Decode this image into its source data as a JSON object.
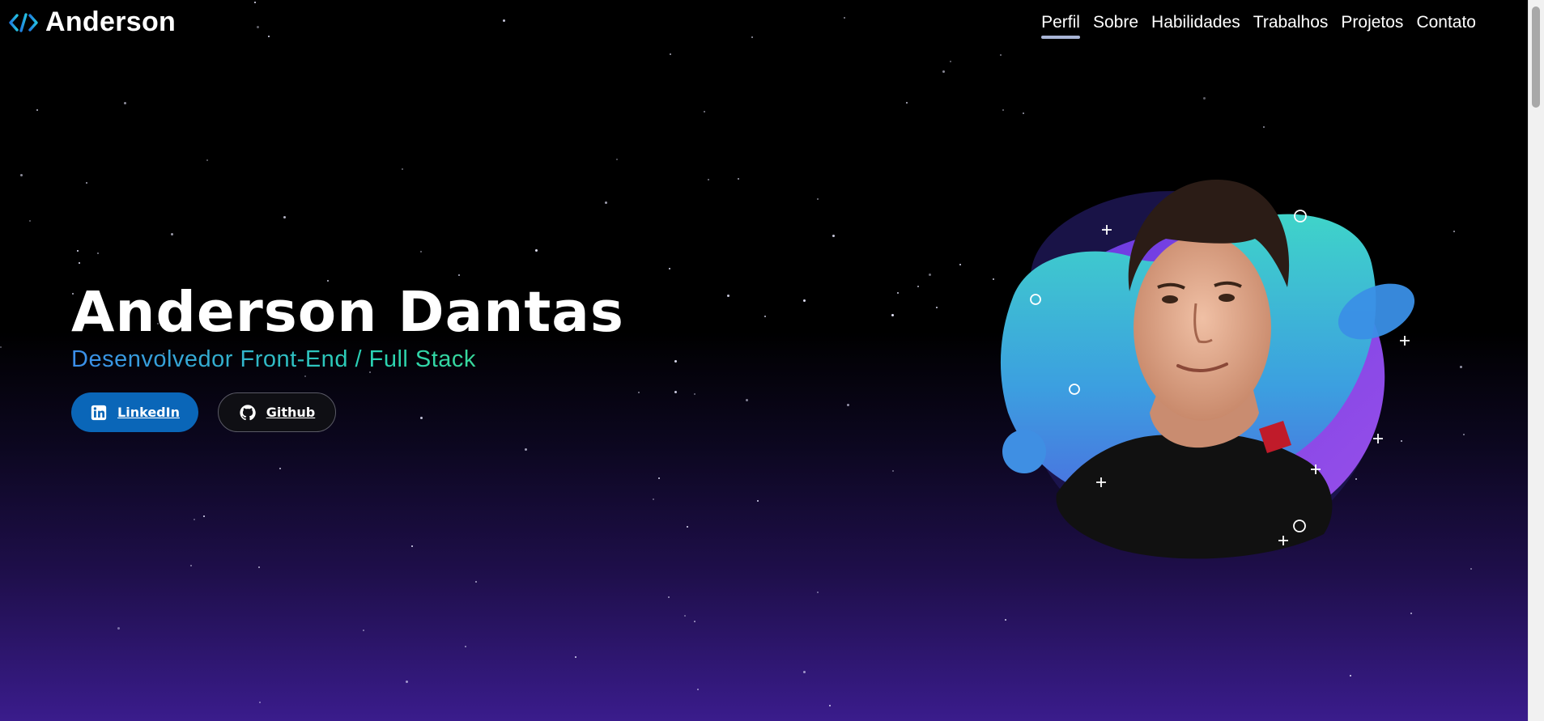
{
  "brand": {
    "name": "Anderson",
    "icon": "code-brackets-icon"
  },
  "nav": {
    "items": [
      {
        "label": "Perfil",
        "active": true
      },
      {
        "label": "Sobre"
      },
      {
        "label": "Habilidades"
      },
      {
        "label": "Trabalhos"
      },
      {
        "label": "Projetos"
      },
      {
        "label": "Contato"
      }
    ]
  },
  "hero": {
    "name": "Anderson Dantas",
    "subtitle": "Desenvolvedor Front-End / Full Stack",
    "buttons": {
      "linkedin": {
        "label": "LinkedIn",
        "icon": "linkedin-icon"
      },
      "github": {
        "label": "Github",
        "icon": "github-icon"
      }
    }
  },
  "colors": {
    "linkedin": "#0a66b8",
    "accent_blue": "#3b8dea",
    "accent_green": "#4ddf79",
    "blob_teal": "#3fd4c9",
    "blob_purple": "#8a4de8"
  }
}
